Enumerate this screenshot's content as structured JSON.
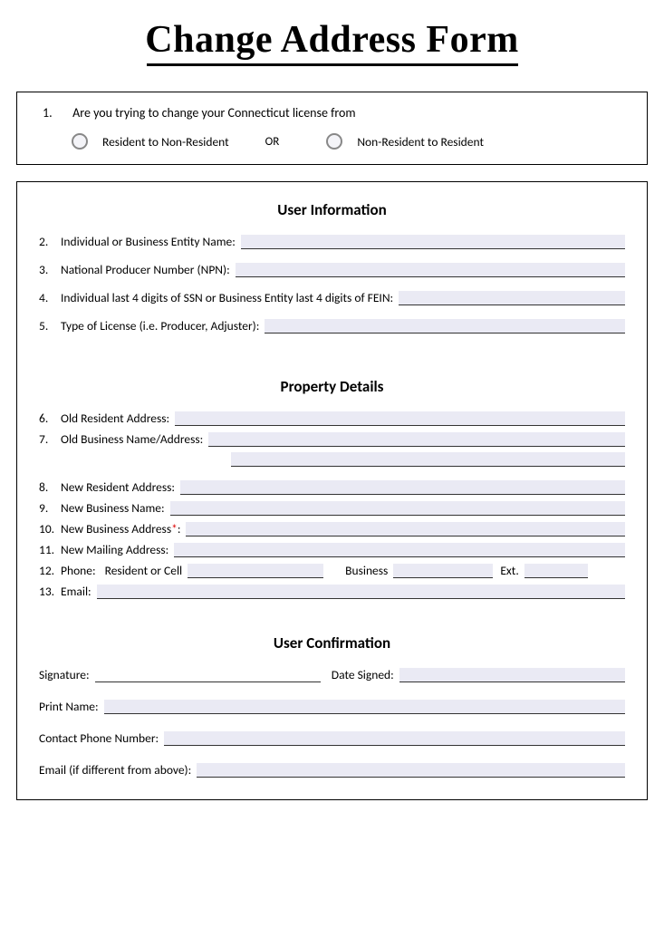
{
  "title": "Change Address Form",
  "box1": {
    "num": "1.",
    "question": "Are you trying to change your Connecticut license from",
    "opt1": "Resident to Non-Resident",
    "or": "OR",
    "opt2": "Non-Resident to Resident"
  },
  "sections": {
    "user_info_title": "User Information",
    "property_title": "Property Details",
    "confirm_title": "User Confirmation"
  },
  "fields": {
    "f2": {
      "num": "2.",
      "label": "Individual or Business Entity Name:"
    },
    "f3": {
      "num": "3.",
      "label": "National Producer Number (NPN):"
    },
    "f4": {
      "num": "4.",
      "label": "Individual last 4 digits of SSN or Business Entity last 4 digits of FEIN:"
    },
    "f5": {
      "num": "5.",
      "label": "Type of License (i.e. Producer, Adjuster):"
    },
    "f6": {
      "num": "6.",
      "label": "Old Resident Address:"
    },
    "f7": {
      "num": "7.",
      "label": "Old Business Name/Address:"
    },
    "f8": {
      "num": "8.",
      "label": "New Resident Address:"
    },
    "f9": {
      "num": "9.",
      "label": "New Business Name:"
    },
    "f10": {
      "num": "10.",
      "label_a": "New Business Address",
      "star": "*",
      "label_b": ":"
    },
    "f11": {
      "num": "11.",
      "label": "New Mailing Address:"
    },
    "f12": {
      "num": "12.",
      "label": "Phone:",
      "sub1": "Resident or Cell",
      "sub2": "Business",
      "sub3": "Ext."
    },
    "f13": {
      "num": "13.",
      "label": "Email:"
    },
    "sig": "Signature:",
    "date": "Date Signed:",
    "print": "Print Name:",
    "contact": "Contact Phone Number:",
    "email2": "Email (if different from above):"
  }
}
